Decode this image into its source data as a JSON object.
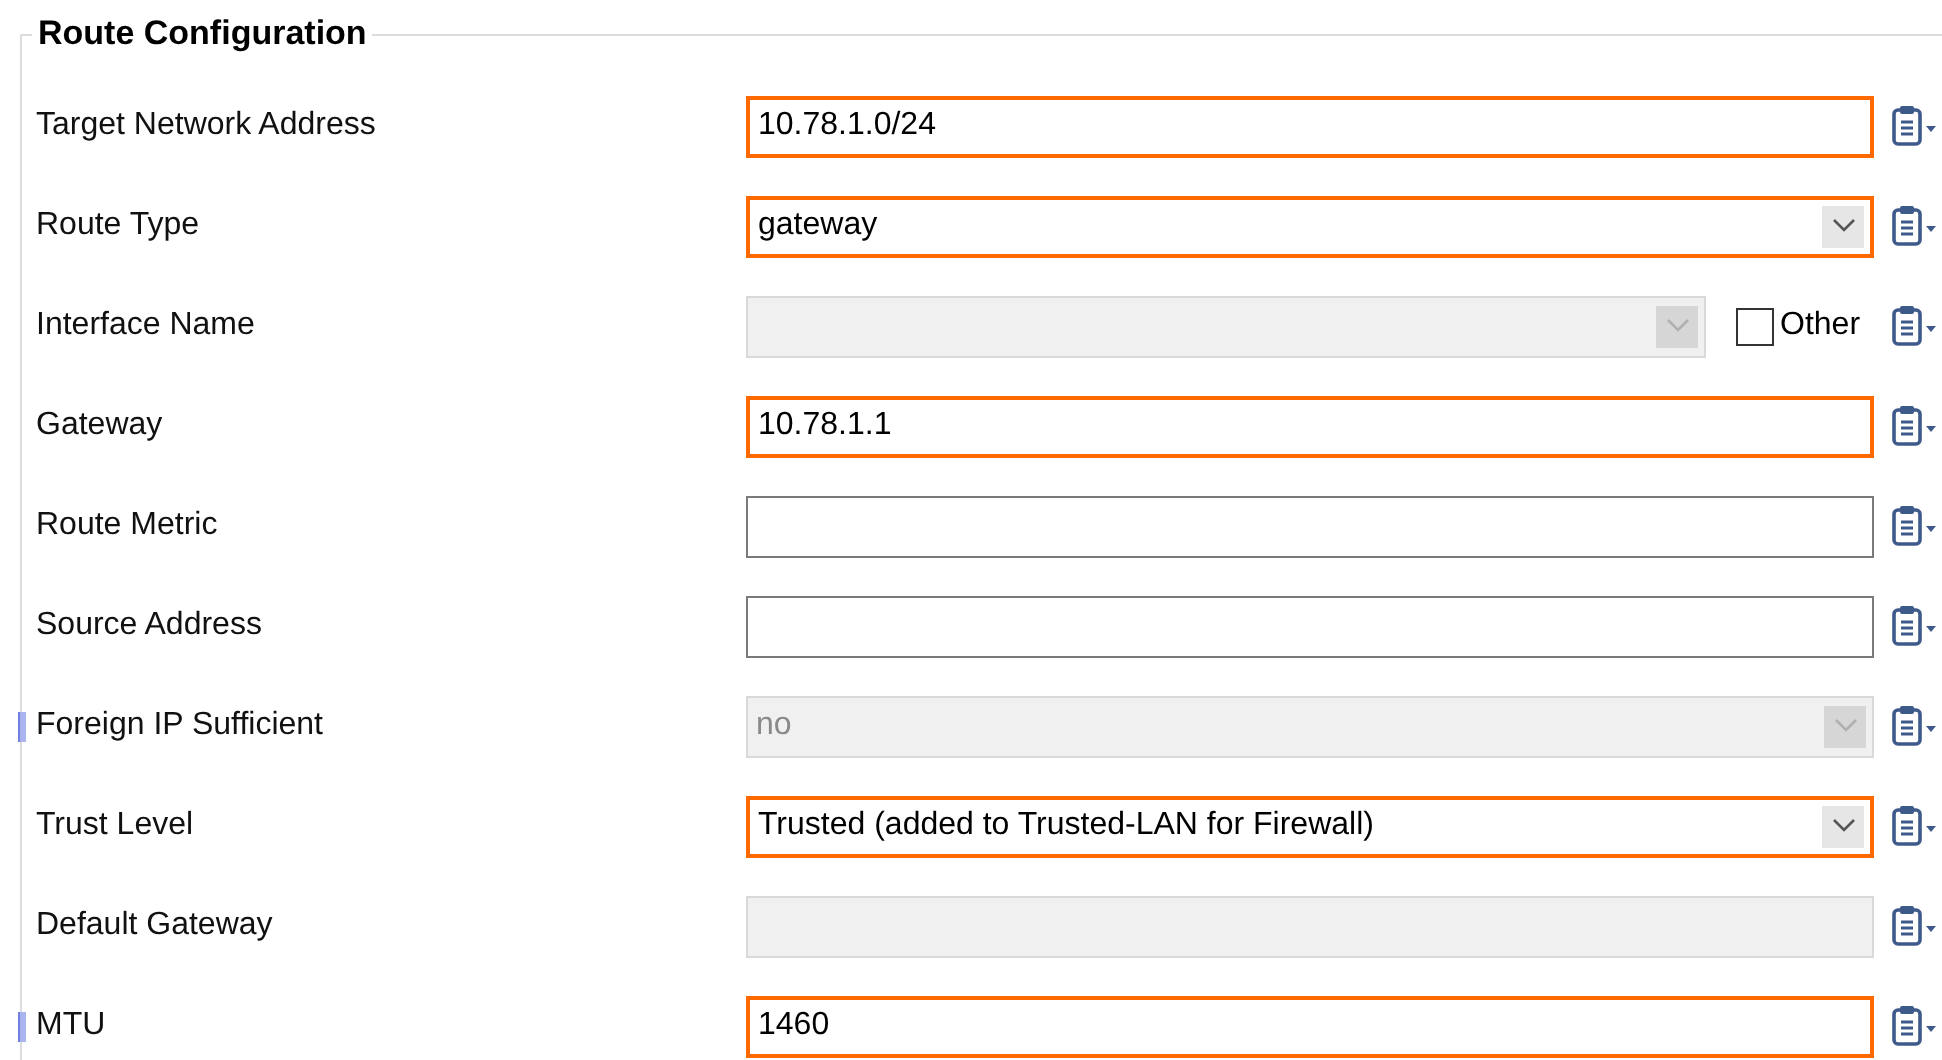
{
  "group": {
    "title": "Route Configuration"
  },
  "rows": [
    {
      "label": "Target Network Address",
      "kind": "text",
      "value": "10.78.1.0/24",
      "modified": true,
      "disabled": false,
      "marker": false
    },
    {
      "label": "Route Type",
      "kind": "select",
      "value": "gateway",
      "modified": true,
      "disabled": false,
      "marker": false
    },
    {
      "label": "Interface Name",
      "kind": "select",
      "modified": false,
      "disabled": true,
      "marker": false,
      "other": {
        "label": "Other",
        "checked": false
      }
    },
    {
      "label": "Gateway",
      "kind": "text",
      "value": "10.78.1.1",
      "modified": true,
      "disabled": false,
      "marker": false
    },
    {
      "label": "Route Metric",
      "kind": "text",
      "modified": false,
      "disabled": false,
      "marker": false
    },
    {
      "label": "Source Address",
      "kind": "text",
      "modified": false,
      "disabled": false,
      "marker": false
    },
    {
      "label": "Foreign IP Sufficient",
      "kind": "select",
      "value": "no",
      "modified": false,
      "disabled": true,
      "marker": true
    },
    {
      "label": "Trust Level",
      "kind": "select",
      "value": "Trusted (added to Trusted-LAN for Firewall)",
      "modified": true,
      "disabled": false,
      "marker": false
    },
    {
      "label": "Default Gateway",
      "kind": "text",
      "modified": false,
      "disabled": true,
      "marker": false
    },
    {
      "label": "MTU",
      "kind": "text",
      "value": "1460",
      "modified": true,
      "disabled": false,
      "marker": true
    }
  ]
}
